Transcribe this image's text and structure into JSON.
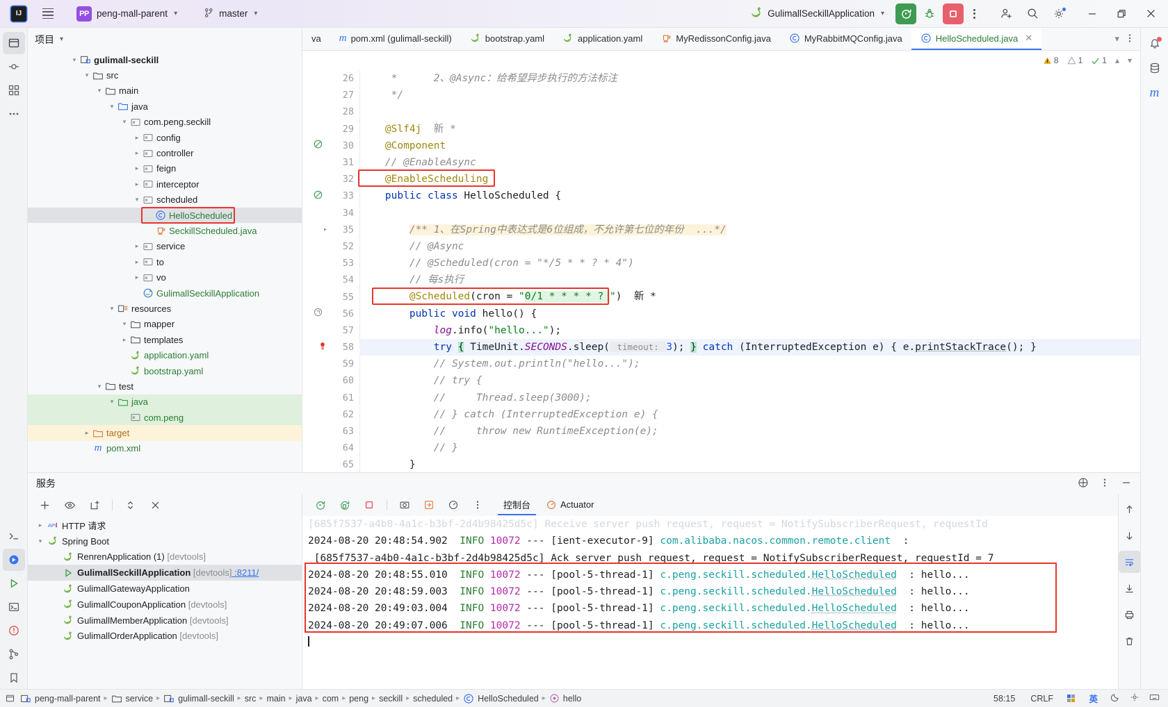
{
  "titlebar": {
    "ide_logo": "IJ",
    "project_badge": "PP",
    "project_name": "peng-mall-parent",
    "branch": "master",
    "run_config": "GulimallSeckillApplication"
  },
  "project_pane": {
    "title": "项目",
    "tree": [
      {
        "depth": 3,
        "arrow": "v",
        "icon": "module-icon",
        "label": "gulimall-seckill",
        "style": "bold"
      },
      {
        "depth": 4,
        "arrow": "v",
        "icon": "folder-icon",
        "label": "src",
        "style": ""
      },
      {
        "depth": 5,
        "arrow": "v",
        "icon": "folder-icon",
        "label": "main",
        "style": ""
      },
      {
        "depth": 6,
        "arrow": "v",
        "icon": "source-folder-icon",
        "label": "java",
        "style": ""
      },
      {
        "depth": 7,
        "arrow": "v",
        "icon": "package-icon",
        "label": "com.peng.seckill",
        "style": ""
      },
      {
        "depth": 8,
        "arrow": ">",
        "icon": "package-icon",
        "label": "config",
        "style": ""
      },
      {
        "depth": 8,
        "arrow": ">",
        "icon": "package-icon",
        "label": "controller",
        "style": ""
      },
      {
        "depth": 8,
        "arrow": ">",
        "icon": "package-icon",
        "label": "feign",
        "style": ""
      },
      {
        "depth": 8,
        "arrow": ">",
        "icon": "package-icon",
        "label": "interceptor",
        "style": ""
      },
      {
        "depth": 8,
        "arrow": "v",
        "icon": "package-icon",
        "label": "scheduled",
        "style": ""
      },
      {
        "depth": 9,
        "arrow": "",
        "icon": "class-icon",
        "label": "HelloScheduled",
        "style": "selected-green"
      },
      {
        "depth": 9,
        "arrow": "",
        "icon": "java-file-icon",
        "label": "SeckillScheduled.java",
        "style": "green"
      },
      {
        "depth": 8,
        "arrow": ">",
        "icon": "package-icon",
        "label": "service",
        "style": ""
      },
      {
        "depth": 8,
        "arrow": ">",
        "icon": "package-icon",
        "label": "to",
        "style": ""
      },
      {
        "depth": 8,
        "arrow": ">",
        "icon": "package-icon",
        "label": "vo",
        "style": ""
      },
      {
        "depth": 8,
        "arrow": "",
        "icon": "spring-class-icon",
        "label": "GulimallSeckillApplication",
        "style": "green"
      },
      {
        "depth": 6,
        "arrow": "v",
        "icon": "resources-folder-icon",
        "label": "resources",
        "style": ""
      },
      {
        "depth": 7,
        "arrow": "v",
        "icon": "folder-icon",
        "label": "mapper",
        "style": ""
      },
      {
        "depth": 7,
        "arrow": ">",
        "icon": "folder-icon",
        "label": "templates",
        "style": ""
      },
      {
        "depth": 7,
        "arrow": "",
        "icon": "yaml-spring-icon",
        "label": "application.yaml",
        "style": "green"
      },
      {
        "depth": 7,
        "arrow": "",
        "icon": "yaml-spring-icon",
        "label": "bootstrap.yaml",
        "style": "green"
      },
      {
        "depth": 5,
        "arrow": "v",
        "icon": "folder-icon",
        "label": "test",
        "style": ""
      },
      {
        "depth": 6,
        "arrow": "v",
        "icon": "test-source-folder-icon",
        "label": "java",
        "style": "row-green"
      },
      {
        "depth": 7,
        "arrow": "",
        "icon": "package-icon",
        "label": "com.peng",
        "style": "row-green"
      },
      {
        "depth": 4,
        "arrow": ">",
        "icon": "target-folder-icon",
        "label": "target",
        "style": "row-yellow"
      },
      {
        "depth": 4,
        "arrow": "",
        "icon": "maven-icon",
        "label": "pom.xml",
        "style": "green"
      }
    ]
  },
  "editor": {
    "tabs": [
      {
        "label": "va",
        "icon": "truncated-tab",
        "active": false
      },
      {
        "label": "pom.xml (gulimall-seckill)",
        "icon": "maven-icon",
        "active": false
      },
      {
        "label": "bootstrap.yaml",
        "icon": "yaml-spring-icon",
        "active": false
      },
      {
        "label": "application.yaml",
        "icon": "yaml-spring-icon",
        "active": false
      },
      {
        "label": "MyRedissonConfig.java",
        "icon": "java-file-icon",
        "active": false
      },
      {
        "label": "MyRabbitMQConfig.java",
        "icon": "class-icon",
        "active": false
      },
      {
        "label": "HelloScheduled.java",
        "icon": "class-icon",
        "active": true
      }
    ],
    "inspections": {
      "warnings": "8",
      "weak_warnings": "1",
      "typos": "1"
    },
    "lines": [
      {
        "n": "26",
        "mark": "",
        "html": "     *      2、@Async：给希望异步执行的方法标注",
        "kind": "comment"
      },
      {
        "n": "27",
        "mark": "",
        "html": "     */",
        "kind": "comment"
      },
      {
        "n": "28",
        "mark": "",
        "html": "",
        "kind": "plain"
      },
      {
        "n": "29",
        "mark": "",
        "html": "    @Slf4j",
        "kind": "ann",
        "suffix": "新 *"
      },
      {
        "n": "30",
        "mark": "bean",
        "html": "    @Component",
        "kind": "ann"
      },
      {
        "n": "31",
        "mark": "",
        "html": "    // @EnableAsync",
        "kind": "comment"
      },
      {
        "n": "32",
        "mark": "",
        "html": "    @EnableScheduling",
        "kind": "ann",
        "boxed": true
      },
      {
        "n": "33",
        "mark": "bean",
        "html": "    public class HelloScheduled {",
        "kind": "decl"
      },
      {
        "n": "34",
        "mark": "",
        "html": "",
        "kind": "plain"
      },
      {
        "n": "35",
        "mark": "fold",
        "html": "        /** 1、在Spring中表达式是6位组成，不允许第七位的年份  ...*/",
        "kind": "doc-fold"
      },
      {
        "n": "52",
        "mark": "",
        "html": "        // @Async",
        "kind": "comment"
      },
      {
        "n": "53",
        "mark": "",
        "html": "        // @Scheduled(cron = \"*/5 * * ? * 4\")",
        "kind": "comment"
      },
      {
        "n": "54",
        "mark": "",
        "html": "        // 每s执行",
        "kind": "comment"
      },
      {
        "n": "55",
        "mark": "",
        "html": "        @Scheduled(cron = \"0/1 * * * * ? \")",
        "kind": "scheduled",
        "boxed": true,
        "suffix": "新 *"
      },
      {
        "n": "56",
        "mark": "method",
        "html": "        public void hello() {",
        "kind": "decl"
      },
      {
        "n": "57",
        "mark": "",
        "html": "            log.info(\"hello...\");",
        "kind": "logcall"
      },
      {
        "n": "58",
        "mark": "error",
        "html": "            try { TimeUnit.SECONDS.sleep( timeout: 3); } catch (InterruptedException e) { e.printStackTrace(); }",
        "kind": "trycatch",
        "highlight": true
      },
      {
        "n": "59",
        "mark": "",
        "html": "            // System.out.println(\"hello...\");",
        "kind": "comment"
      },
      {
        "n": "60",
        "mark": "",
        "html": "            // try {",
        "kind": "comment"
      },
      {
        "n": "61",
        "mark": "",
        "html": "            //     Thread.sleep(3000);",
        "kind": "comment"
      },
      {
        "n": "62",
        "mark": "",
        "html": "            // } catch (InterruptedException e) {",
        "kind": "comment"
      },
      {
        "n": "63",
        "mark": "",
        "html": "            //     throw new RuntimeException(e);",
        "kind": "comment"
      },
      {
        "n": "64",
        "mark": "",
        "html": "            // }",
        "kind": "comment"
      },
      {
        "n": "65",
        "mark": "",
        "html": "        }",
        "kind": "plain"
      }
    ]
  },
  "services": {
    "title": "服务",
    "tree": [
      {
        "depth": 0,
        "arrow": ">",
        "icon": "http-icon",
        "label": "HTTP 请求",
        "suffix": "",
        "style": ""
      },
      {
        "depth": 0,
        "arrow": "v",
        "icon": "spring-icon",
        "label": "Spring Boot",
        "suffix": "",
        "style": ""
      },
      {
        "depth": 1,
        "arrow": "",
        "icon": "spring-icon",
        "label": "RenrenApplication (1)",
        "suffix": "[devtools]",
        "style": ""
      },
      {
        "depth": 1,
        "arrow": "",
        "icon": "run-icon",
        "label": "GulimallSeckillApplication",
        "suffix": "[devtools]",
        "link": ":8211/",
        "style": "selected-bold"
      },
      {
        "depth": 1,
        "arrow": "",
        "icon": "spring-icon",
        "label": "GulimallGatewayApplication",
        "suffix": "",
        "style": ""
      },
      {
        "depth": 1,
        "arrow": "",
        "icon": "spring-icon",
        "label": "GulimallCouponApplication",
        "suffix": "[devtools]",
        "style": ""
      },
      {
        "depth": 1,
        "arrow": "",
        "icon": "spring-icon",
        "label": "GulimallMemberApplication",
        "suffix": "[devtools]",
        "style": ""
      },
      {
        "depth": 1,
        "arrow": "",
        "icon": "spring-icon",
        "label": "GulimallOrderApplication",
        "suffix": "[devtools]",
        "style": ""
      }
    ]
  },
  "console": {
    "tabs": [
      {
        "label": "控制台",
        "icon": "",
        "active": true
      },
      {
        "label": "Actuator",
        "icon": "actuator-icon",
        "active": false
      }
    ],
    "lines": [
      {
        "kind": "faded",
        "text": "[685f7537-a4b0-4a1c-b3bf-2d4b98425d5c] Receive server push request, request = NotifySubscriberRequest, requestId"
      },
      {
        "kind": "log",
        "date": "2024-08-20 20:48:54.902",
        "level": "INFO",
        "pid": "10072",
        "thread": "[ient-executor-9]",
        "logger": "com.alibaba.nacos.common.remote.client",
        "msg": ":"
      },
      {
        "kind": "cont",
        "text": " [685f7537-a4b0-4a1c-b3bf-2d4b98425d5c] Ack server push request, request = NotifySubscriberRequest, requestId = 7"
      },
      {
        "kind": "log",
        "date": "2024-08-20 20:48:55.010",
        "level": "INFO",
        "pid": "10072",
        "thread": "[pool-5-thread-1]",
        "logger": "c.peng.seckill.scheduled.HelloScheduled",
        "msg": ": hello...",
        "boxed": true
      },
      {
        "kind": "log",
        "date": "2024-08-20 20:48:59.003",
        "level": "INFO",
        "pid": "10072",
        "thread": "[pool-5-thread-1]",
        "logger": "c.peng.seckill.scheduled.HelloScheduled",
        "msg": ": hello...",
        "boxed": true
      },
      {
        "kind": "log",
        "date": "2024-08-20 20:49:03.004",
        "level": "INFO",
        "pid": "10072",
        "thread": "[pool-5-thread-1]",
        "logger": "c.peng.seckill.scheduled.HelloScheduled",
        "msg": ": hello...",
        "boxed": true
      },
      {
        "kind": "log",
        "date": "2024-08-20 20:49:07.006",
        "level": "INFO",
        "pid": "10072",
        "thread": "[pool-5-thread-1]",
        "logger": "c.peng.seckill.scheduled.HelloScheduled",
        "msg": ": hello...",
        "boxed": true
      }
    ]
  },
  "status_bar": {
    "breadcrumbs": [
      "peng-mall-parent",
      "service",
      "gulimall-seckill",
      "src",
      "main",
      "java",
      "com",
      "peng",
      "seckill",
      "scheduled",
      "HelloScheduled",
      "hello"
    ],
    "caret": "58:15",
    "line_separator": "CRLF",
    "ime_label": "英"
  },
  "colors": {
    "accent": "#3573f0",
    "run_green": "#3d9c52",
    "stop_red": "#e8606b",
    "highlight_box": "#e8352c",
    "purple_badge": "#9350e0"
  }
}
